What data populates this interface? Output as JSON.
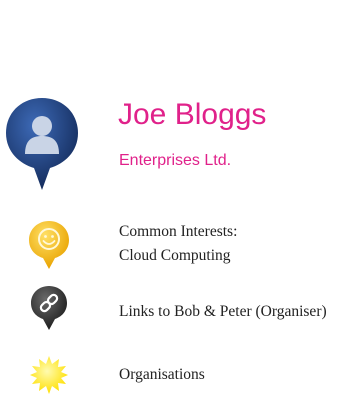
{
  "profile": {
    "name": "Joe Bloggs",
    "company": "Enterprises Ltd.",
    "icon": "user-silhouette-icon",
    "pin_color": "#1f3f7a"
  },
  "rows": [
    {
      "icon": "smiley-icon",
      "color": "#f2b200",
      "lines": [
        "Common Interests:",
        "Cloud Computing"
      ]
    },
    {
      "icon": "link-icon",
      "color": "#3a3a3a",
      "lines": [
        "Links to Bob & Peter (Organiser)"
      ]
    },
    {
      "icon": "sun-icon",
      "color": "#ffe400",
      "lines": [
        "Organisations"
      ]
    }
  ]
}
